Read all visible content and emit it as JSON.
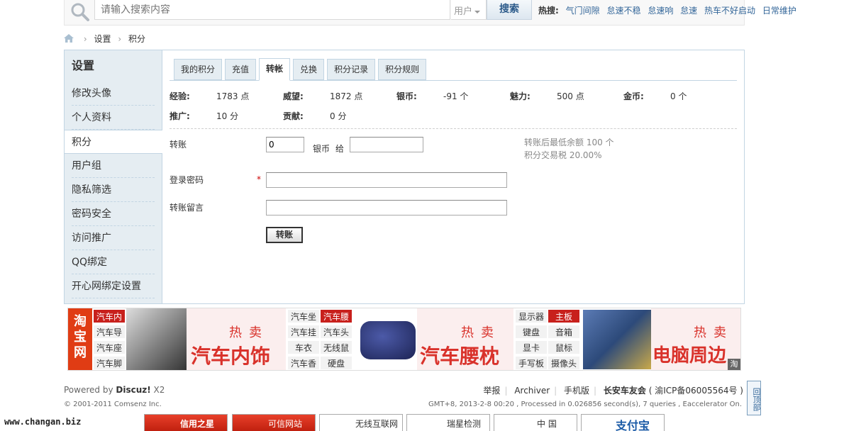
{
  "search": {
    "placeholder": "请输入搜索内容",
    "type": "用户",
    "button": "搜索",
    "hot_label": "热搜:",
    "hot_items": [
      "气门间隙",
      "怠速不稳",
      "怠速响",
      "怠速",
      "热车不好启动",
      "日常维护"
    ]
  },
  "breadcrumb": [
    "设置",
    "积分"
  ],
  "sidebar": {
    "title": "设置",
    "items": [
      "修改头像",
      "个人资料",
      "积分",
      "用户组",
      "隐私筛选",
      "密码安全",
      "访问推广",
      "QQ绑定",
      "开心网绑定设置"
    ],
    "active_index": 2
  },
  "tabs": [
    "我的积分",
    "充值",
    "转帐",
    "兑换",
    "积分记录",
    "积分规则"
  ],
  "active_tab": 2,
  "stats": [
    {
      "label": "经验:",
      "value": "1783 点"
    },
    {
      "label": "威望:",
      "value": "1872 点"
    },
    {
      "label": "银币:",
      "value": "-91 个"
    },
    {
      "label": "魅力:",
      "value": "500 点"
    },
    {
      "label": "金币:",
      "value": "0 个"
    },
    {
      "label": "推广:",
      "value": "10 分"
    },
    {
      "label": "贡献:",
      "value": "0 分"
    }
  ],
  "transfer": {
    "label": "转账",
    "amount": "0",
    "unit": "银币",
    "to": "给",
    "password_label": "登录密码",
    "required_mark": "*",
    "note_label": "转账留言",
    "submit": "转账",
    "info_min_balance": "转账后最低余额  100 个",
    "info_tax": "积分交易税  20.00%"
  },
  "ad": {
    "logo": "淘宝网",
    "kw_left": [
      "汽车内",
      "汽车导",
      "汽车座",
      "汽车脚"
    ],
    "kw_mid": [
      "汽车坐",
      "汽车腰",
      "汽车挂",
      "汽车头",
      "车衣",
      "无线鼠",
      "汽车香",
      "硬盘"
    ],
    "kw_right": [
      "显示器",
      "主板",
      "键盘",
      "音箱",
      "显卡",
      "鼠标",
      "手写板",
      "摄像头"
    ],
    "hot": "热卖",
    "big1": "汽车内饰",
    "big2": "汽车腰枕",
    "big3": "电脑周边",
    "tag": "淘"
  },
  "footer": {
    "powered_prefix": "Powered by ",
    "powered_brand": "Discuz!",
    "powered_ver": " X2",
    "copyright": "© 2001-2011 Comsenz Inc.",
    "links": [
      "举报",
      "Archiver",
      "手机版"
    ],
    "site": "长安车友会",
    "icp": "( 渝ICP备06005564号 )",
    "meta": "GMT+8, 2013-2-8 00:20 , Processed in 0.026856 second(s), 7 queries , Eaccelerator On.",
    "gotop": "回顶部",
    "watermark": "www.changan.biz",
    "badges": [
      "信用之星",
      "可信网站",
      "无线互联网",
      "瑞星检测",
      "中 国",
      "支付宝"
    ]
  },
  "colors": {
    "link": "#336699",
    "border": "#c2d5e3",
    "sidebar_bg": "#e5edf2",
    "ad_red": "#c8201c"
  }
}
